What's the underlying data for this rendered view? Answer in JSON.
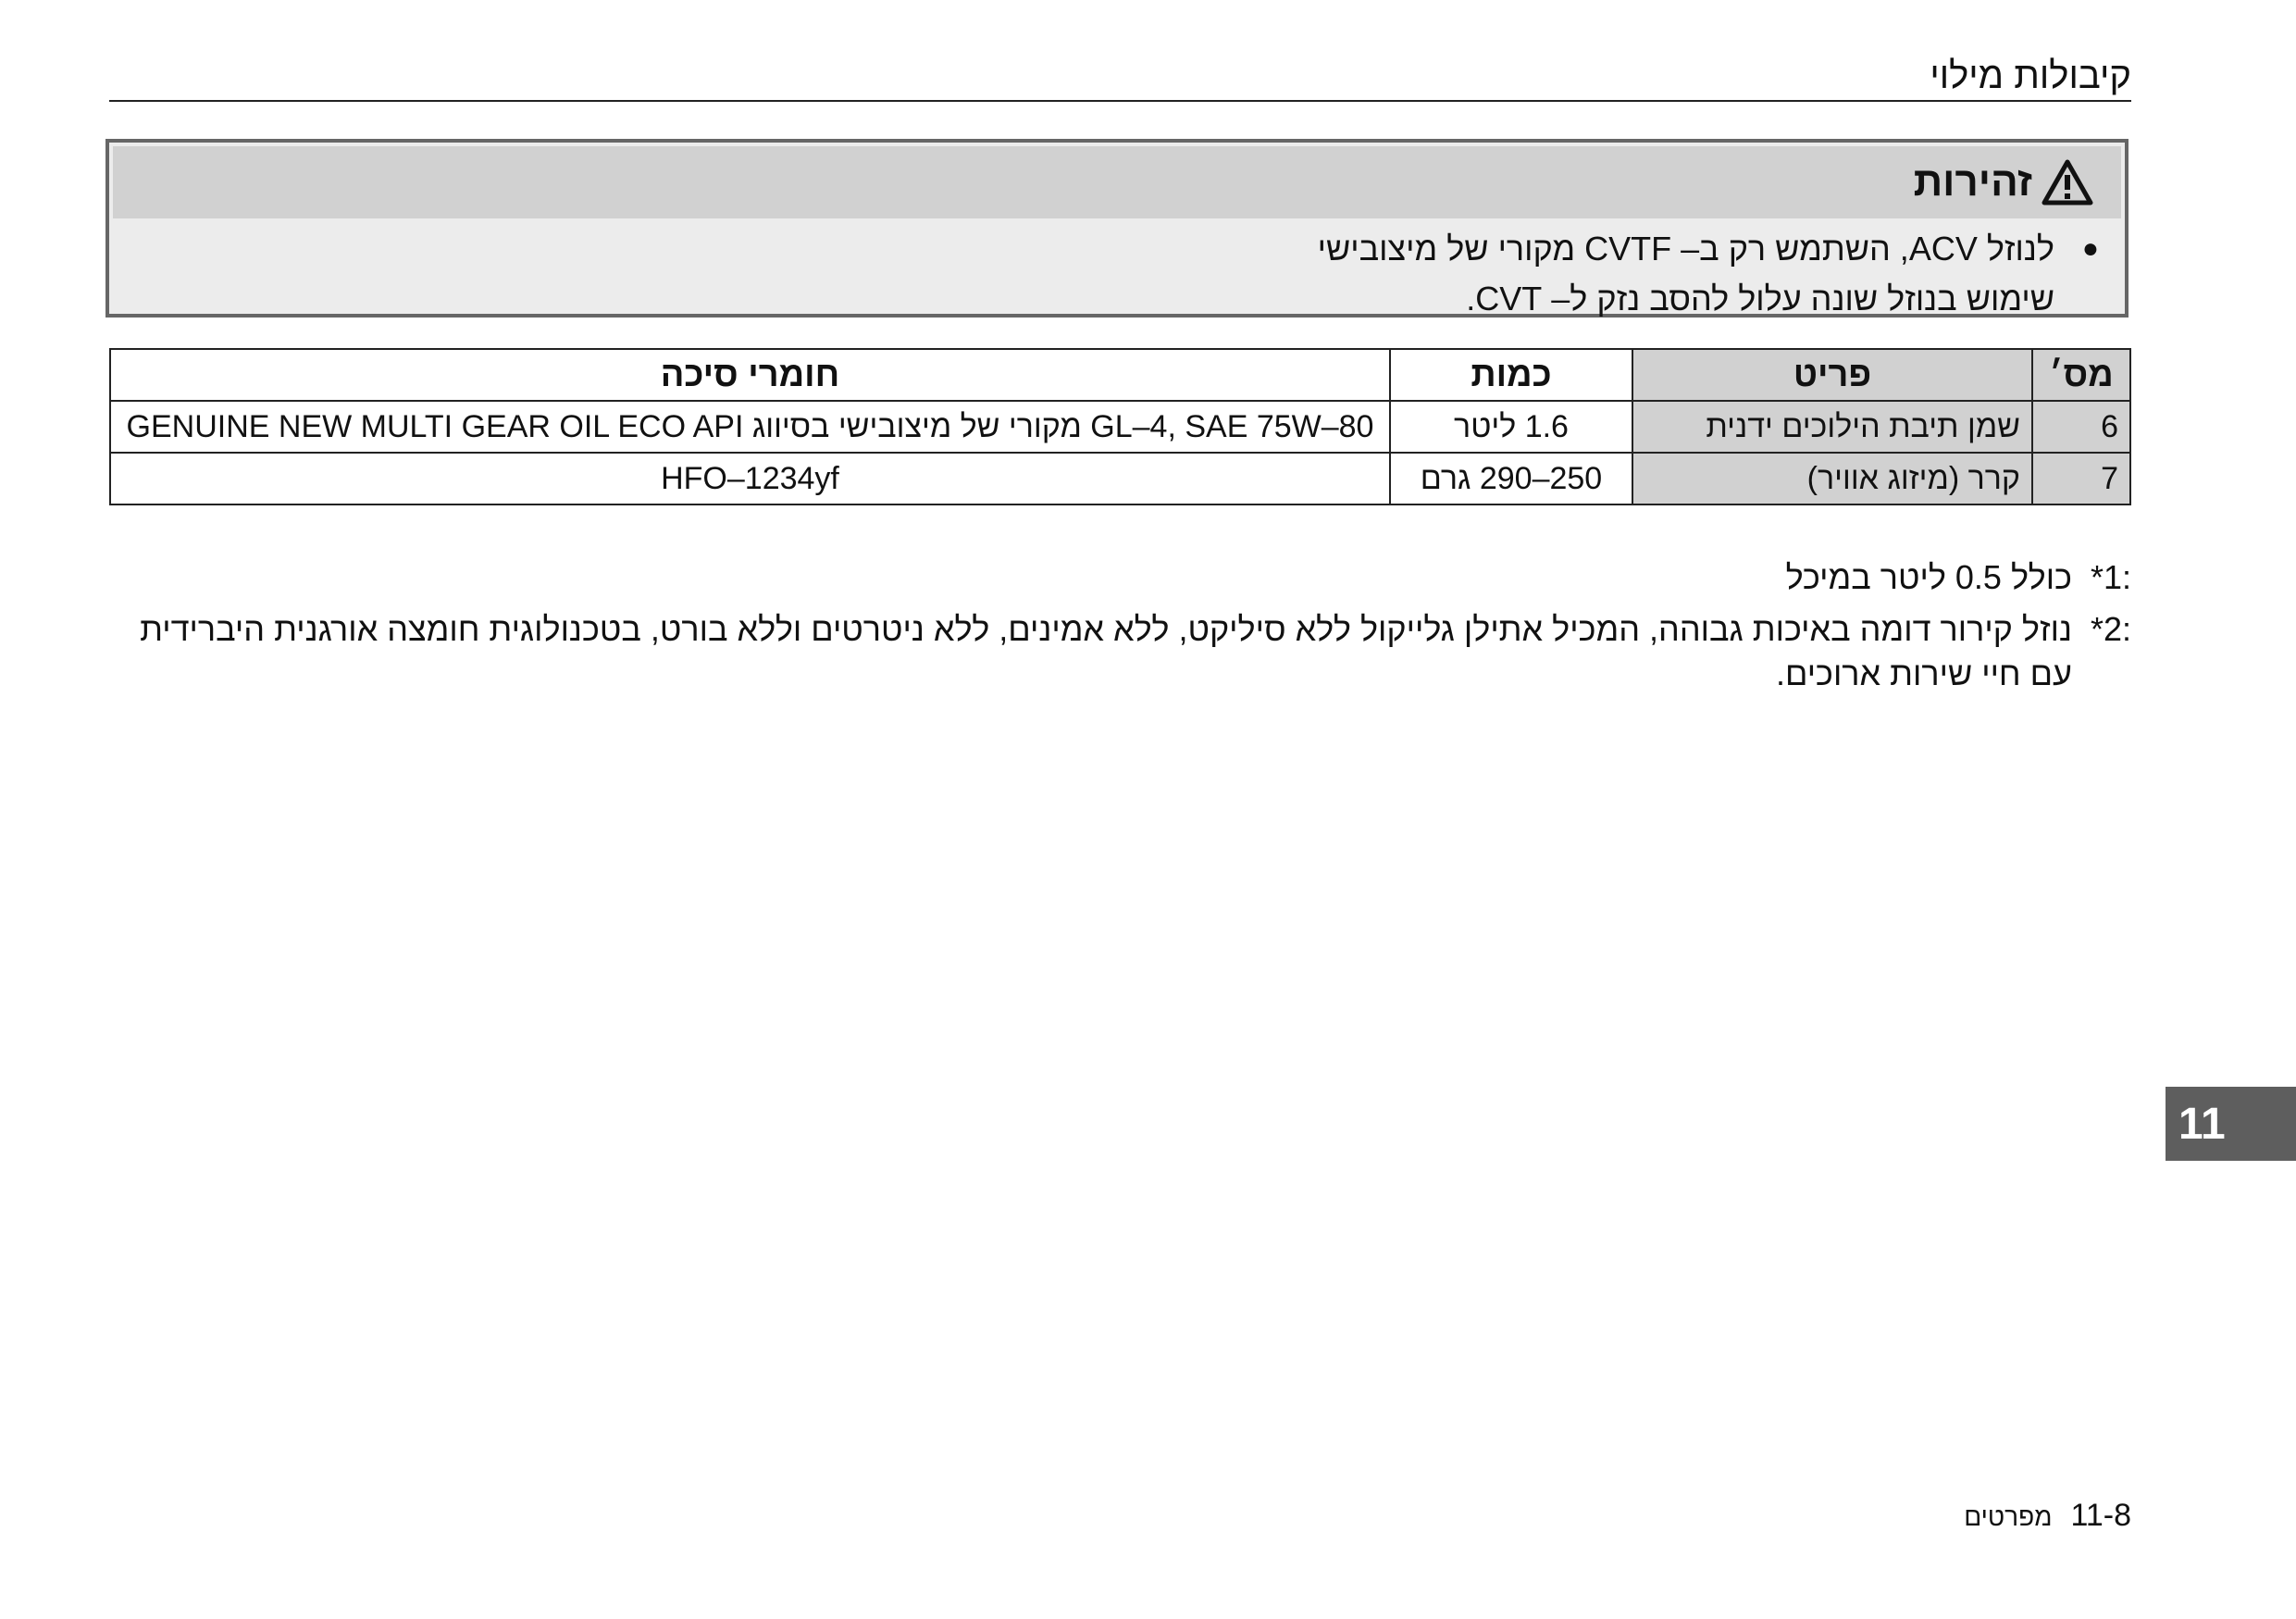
{
  "header": {
    "title": "קיבולות מילוי"
  },
  "warning": {
    "title": "זהירות",
    "icon": "warning-triangle-icon",
    "lines": [
      "לנוזל ACV, השתמש רק ב– CVTF מקורי של מיצובישי",
      "שימוש בנוזל שונה עלול להסב נזק ל– CVT."
    ]
  },
  "table": {
    "headers": {
      "num": "מס׳",
      "item": "פריט",
      "qty": "כמות",
      "material": "חומרי סיכה"
    },
    "rows": [
      {
        "num": "6",
        "item": "שמן תיבת הילוכים ידנית",
        "qty": "1.6 ליטר",
        "material": "GL–4, SAE 75W–80 מקורי של מיצובישי בסיווג GENUINE NEW MULTI GEAR OIL ECO API"
      },
      {
        "num": "7",
        "item": "קרר (מיזוג אוויר)",
        "qty": "250–290 גרם",
        "material": "HFO–1234yf"
      }
    ]
  },
  "notes": [
    {
      "mark": "*1:",
      "text": "כולל 0.5 ליטר במיכל"
    },
    {
      "mark": "*2:",
      "text": "נוזל קירור דומה באיכות גבוהה, המכיל אתילן גלייקול ללא סיליקט, ללא אמינים, ללא ניטרטים וללא בורט, בטכנולוגית חומצה אורגנית היברידית עם חיי שירות ארוכים."
    }
  ],
  "chapter_tab": "11",
  "footer": {
    "page_number": "11-8",
    "section": "מפרטים"
  }
}
